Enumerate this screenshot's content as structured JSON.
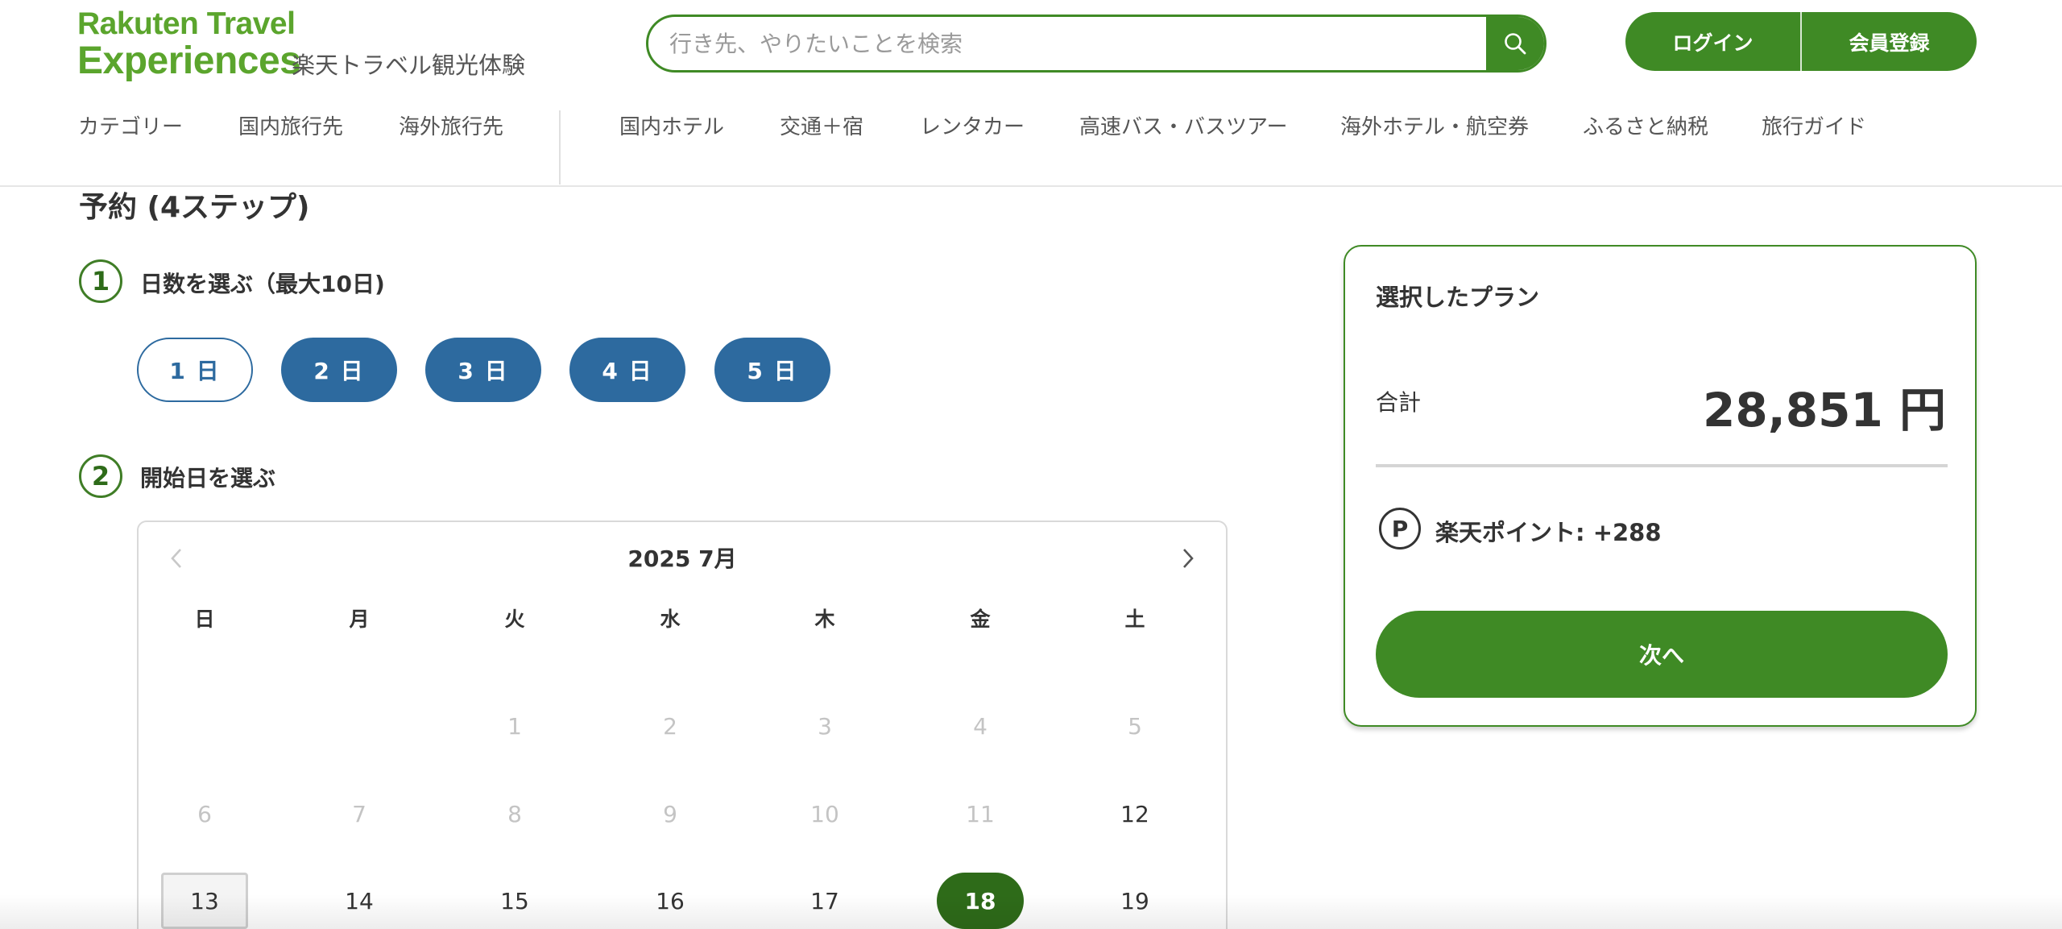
{
  "header": {
    "logo": {
      "line1": "Rakuten Travel",
      "line2": "Experiences",
      "subtitle": "楽天トラベル観光体験"
    },
    "search": {
      "placeholder": "行き先、やりたいことを検索",
      "value": ""
    },
    "login_label": "ログイン",
    "register_label": "会員登録",
    "nav_left": [
      "カテゴリー",
      "国内旅行先",
      "海外旅行先"
    ],
    "nav_right": [
      "国内ホテル",
      "交通＋宿",
      "レンタカー",
      "高速バス・バスツアー",
      "海外ホテル・航空券",
      "ふるさと納税",
      "旅行ガイド"
    ]
  },
  "booking": {
    "title": "予約 (4ステップ)",
    "step1": {
      "number": "1",
      "label": "日数を選ぶ（最大10日)"
    },
    "day_options": [
      "1 日",
      "2 日",
      "3 日",
      "4 日",
      "5 日"
    ],
    "selected_day_index": 0,
    "step2": {
      "number": "2",
      "label": "開始日を選ぶ"
    }
  },
  "calendar": {
    "month_label": "2025 7月",
    "weekdays": [
      "日",
      "月",
      "火",
      "水",
      "木",
      "金",
      "土"
    ],
    "weeks": [
      [
        null,
        null,
        "1",
        "2",
        "3",
        "4",
        "5"
      ],
      [
        "6",
        "7",
        "8",
        "9",
        "10",
        "11",
        "12"
      ],
      [
        "13",
        "14",
        "15",
        "16",
        "17",
        "18",
        "19"
      ]
    ],
    "disabled_days": [
      "1",
      "2",
      "3",
      "4",
      "5",
      "6",
      "7",
      "8",
      "9",
      "10",
      "11"
    ],
    "today": "13",
    "selected": "18"
  },
  "summary": {
    "title": "選択したプラン",
    "total_label": "合計",
    "total_value": "28,851 円",
    "point_icon": "P",
    "points_label": "楽天ポイント:  +288",
    "next_label": "次へ"
  },
  "colors": {
    "brand_green": "#3f8a25",
    "logo_green": "#5ba52d",
    "selected_green": "#2e6b19",
    "day_pill_blue": "#2d6a9f"
  }
}
